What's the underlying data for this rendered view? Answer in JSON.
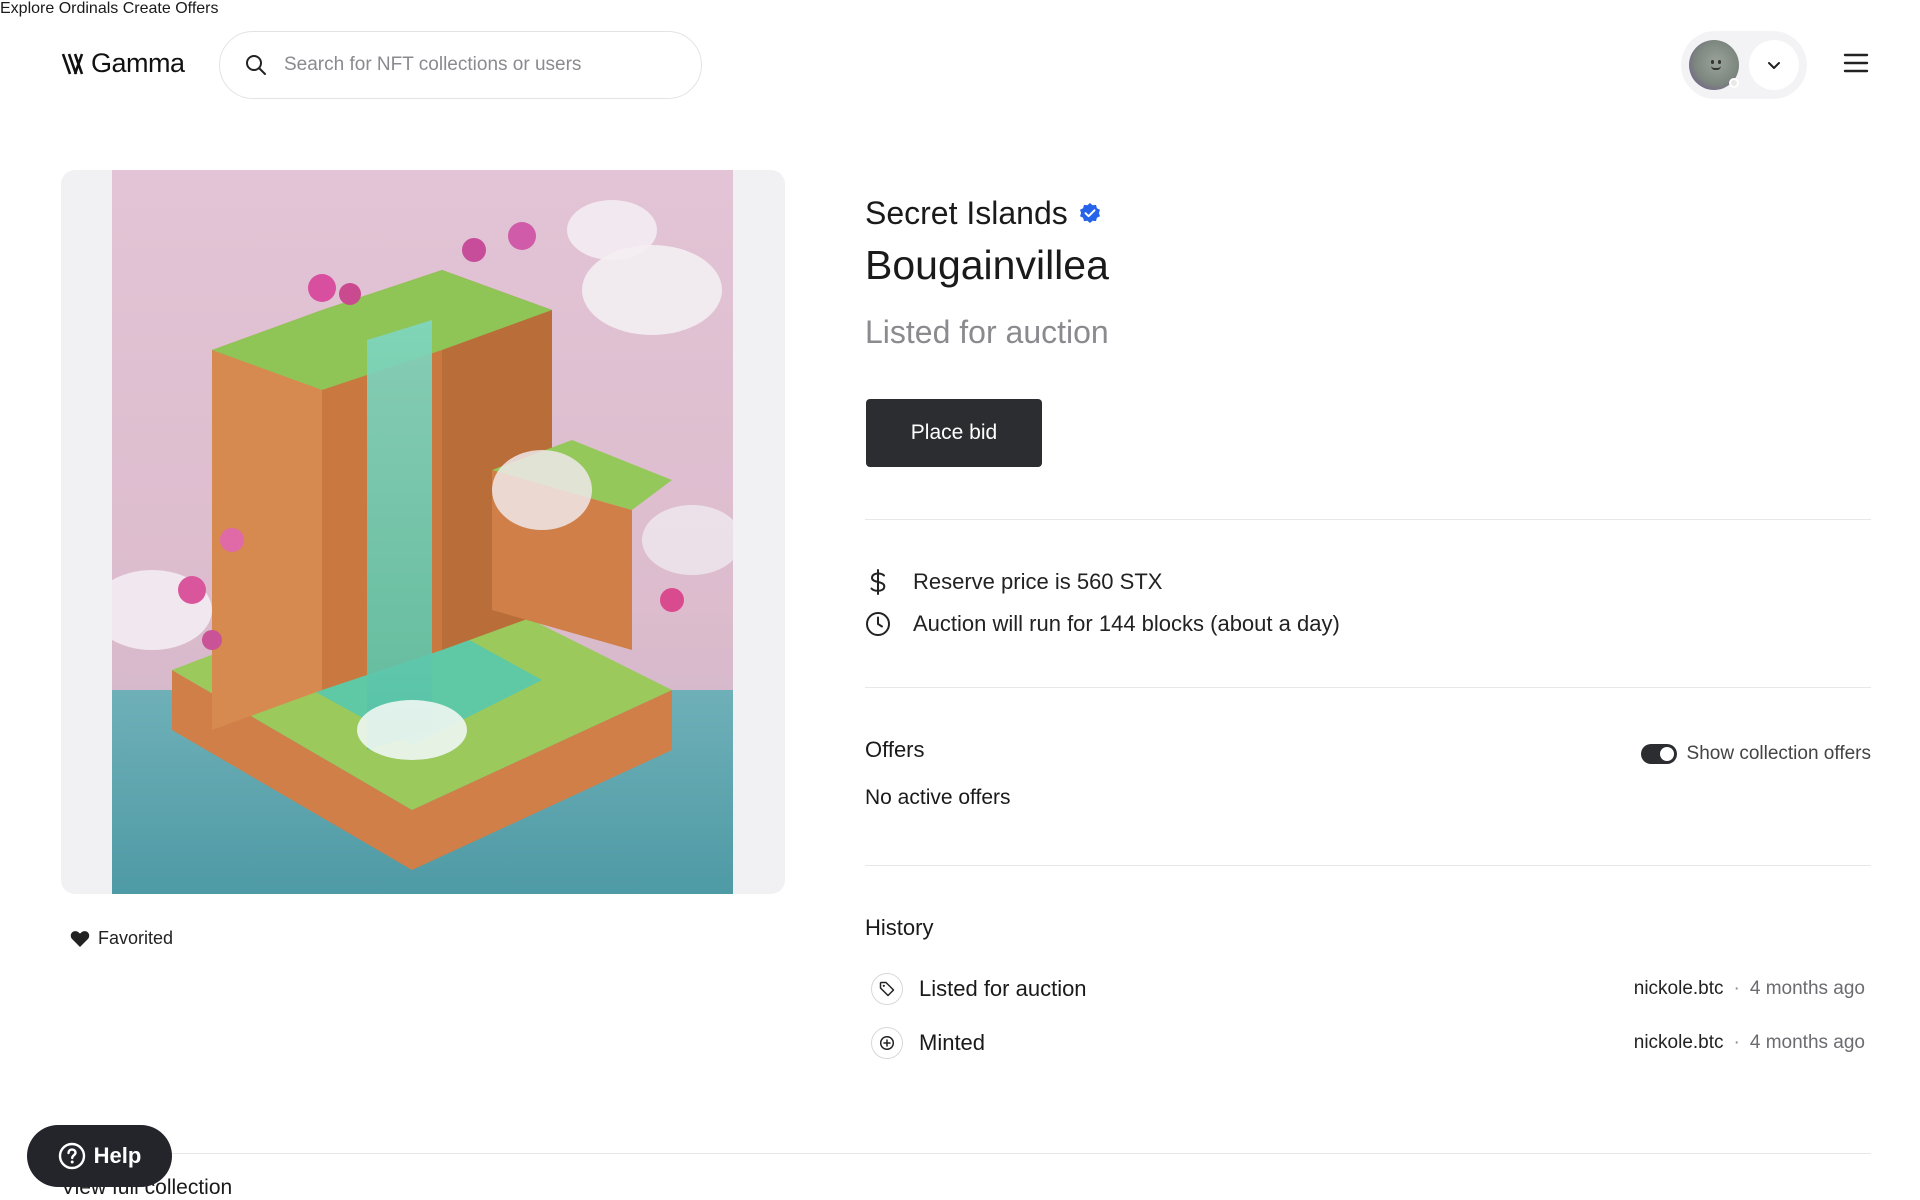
{
  "header": {
    "logo_text": "Gamma",
    "search_placeholder": "Search for NFT collections or users",
    "nav": [
      {
        "label": "Explore"
      },
      {
        "label": "Ordinals"
      },
      {
        "label": "Create"
      },
      {
        "label": "Offers"
      }
    ]
  },
  "artwork": {
    "favorited_label": "Favorited"
  },
  "details": {
    "collection_name": "Secret Islands",
    "nft_name": "Bougainvillea",
    "status": "Listed for auction",
    "place_bid_label": "Place bid",
    "reserve_price": "Reserve price is 560 STX",
    "auction_duration": "Auction will run for 144 blocks (about a day)"
  },
  "offers": {
    "title": "Offers",
    "toggle_label": "Show collection offers",
    "toggle_on": true,
    "empty_text": "No active offers"
  },
  "history": {
    "title": "History",
    "events": [
      {
        "label": "Listed for auction",
        "user": "nickole.btc",
        "separator": "·",
        "time": "4 months ago",
        "icon": "tag-icon"
      },
      {
        "label": "Minted",
        "user": "nickole.btc",
        "separator": "·",
        "time": "4 months ago",
        "icon": "mint-icon"
      }
    ]
  },
  "footer": {
    "view_full_collection": "View full collection",
    "help_label": "Help"
  },
  "colors": {
    "primary_button": "#2b2d30",
    "verified_badge": "#2563eb",
    "muted_text": "#8a8a8f"
  }
}
